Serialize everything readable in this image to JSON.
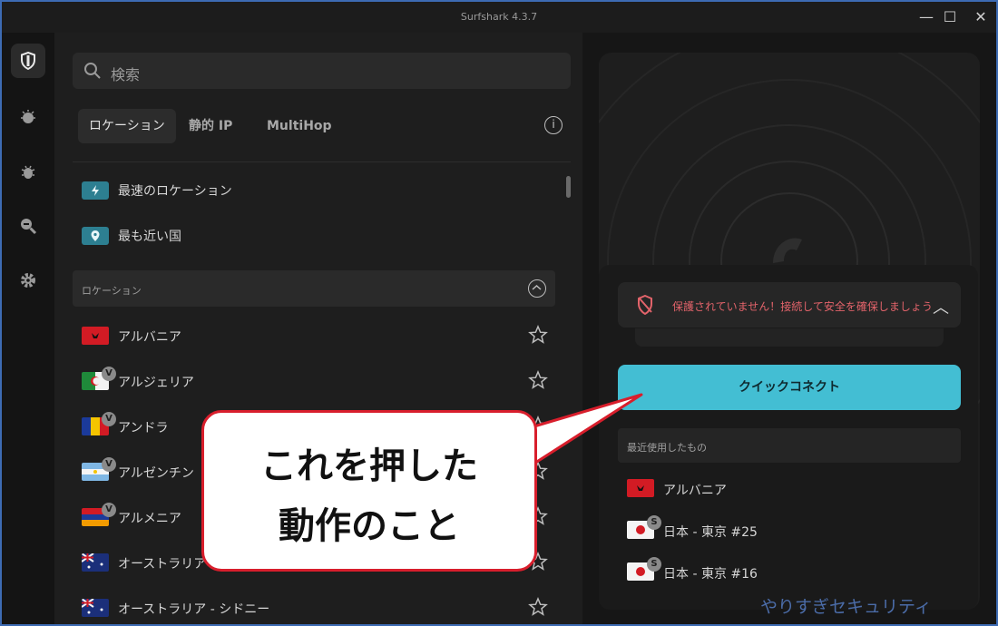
{
  "app": {
    "title": "Surfshark 4.3.7"
  },
  "window_controls": {
    "minimize": "—",
    "maximize": "☐",
    "close": "✕"
  },
  "search": {
    "placeholder": "検索"
  },
  "tabs": [
    {
      "label": "ロケーション",
      "active": true
    },
    {
      "label": "静的 IP",
      "active": false
    },
    {
      "label": "MultiHop",
      "active": false
    }
  ],
  "quick": [
    {
      "label": "最速のロケーション",
      "icon": "lightning-icon"
    },
    {
      "label": "最も近い国",
      "icon": "location-pin-icon"
    }
  ],
  "section_locations": {
    "label": "ロケーション"
  },
  "locations": [
    {
      "name": "アルバニア",
      "badge": ""
    },
    {
      "name": "アルジェリア",
      "badge": "V"
    },
    {
      "name": "アンドラ",
      "badge": "V"
    },
    {
      "name": "アルゼンチン",
      "badge": "V"
    },
    {
      "name": "アルメニア",
      "badge": "V"
    },
    {
      "name": "オーストラリア - パース",
      "badge": ""
    },
    {
      "name": "オーストラリア - シドニー",
      "badge": ""
    }
  ],
  "status": {
    "warning": "保護されていません！接続して安全を確保しましょう",
    "color": "#e2636a"
  },
  "quick_connect": {
    "label": "クイックコネクト",
    "color": "#43bed3"
  },
  "recent": {
    "header": "最近使用したもの",
    "items": [
      {
        "name": "アルバニア",
        "badge": ""
      },
      {
        "name": "日本 - 東京 #25",
        "badge": "S"
      },
      {
        "name": "日本 - 東京 #16",
        "badge": "S"
      }
    ]
  },
  "callout": {
    "line1": "これを押した",
    "line2": "動作のこと",
    "border_color": "#d81e2c"
  },
  "watermark": "やりすぎセキュリティ"
}
